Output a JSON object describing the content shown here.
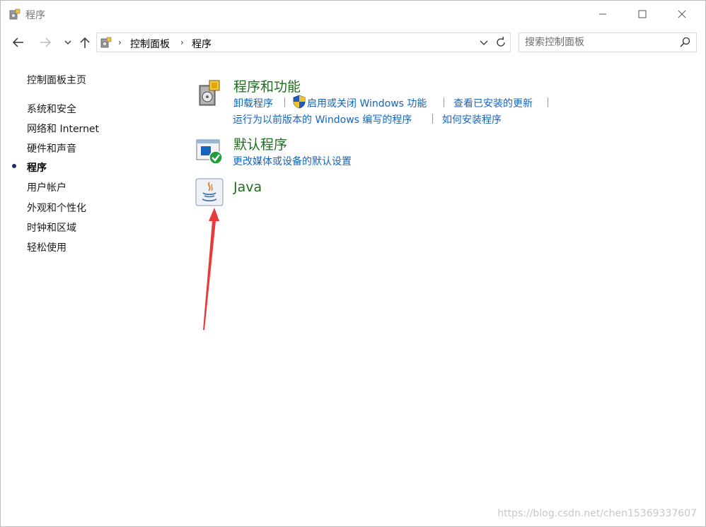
{
  "window": {
    "title": "程序",
    "icon": "control-panel-programs-icon"
  },
  "nav": {
    "back_icon": "arrow-left-icon",
    "forward_icon": "arrow-right-icon",
    "history_icon": "chevron-down-icon",
    "up_icon": "arrow-up-icon",
    "breadcrumb": [
      "控制面板",
      "程序"
    ],
    "refresh_icon": "refresh-icon"
  },
  "search": {
    "placeholder": "搜索控制面板",
    "value": ""
  },
  "sidebar": {
    "items": [
      {
        "label": "控制面板主页",
        "active": false
      },
      {
        "label": "系统和安全",
        "active": false
      },
      {
        "label": "网络和 Internet",
        "active": false
      },
      {
        "label": "硬件和声音",
        "active": false
      },
      {
        "label": "程序",
        "active": true
      },
      {
        "label": "用户帐户",
        "active": false
      },
      {
        "label": "外观和个性化",
        "active": false
      },
      {
        "label": "时钟和区域",
        "active": false
      },
      {
        "label": "轻松使用",
        "active": false
      }
    ]
  },
  "categories": [
    {
      "title": "程序和功能",
      "icon": "programs-features-icon",
      "links_row1": [
        "卸载程序",
        "启用或关闭 Windows 功能",
        "查看已安装的更新"
      ],
      "links_row2": [
        "运行为以前版本的 Windows 编写的程序",
        "如何安装程序"
      ]
    },
    {
      "title": "默认程序",
      "icon": "default-programs-icon",
      "links_row1": [
        "更改媒体或设备的默认设置"
      ]
    },
    {
      "title": "Java",
      "icon": "java-icon"
    }
  ],
  "annotation": {
    "arrow_color": "#e8393b"
  },
  "watermark": "https://blog.csdn.net/chen15369337607",
  "colors": {
    "category_title": "#1e6e1e",
    "link": "#1565c0"
  }
}
